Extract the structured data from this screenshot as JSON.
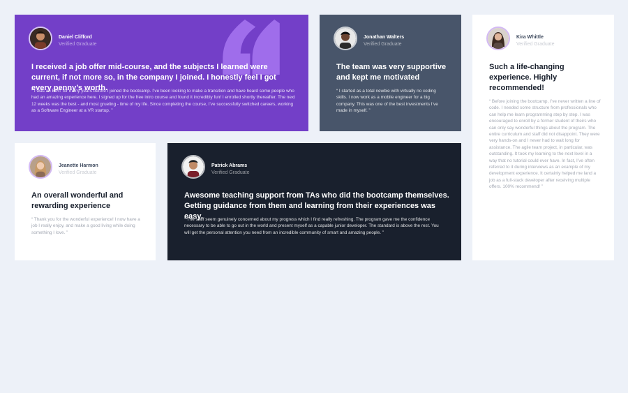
{
  "colors": {
    "page_bg": "#edf1f8",
    "purple": "#733fc8",
    "slate": "#48556a",
    "white": "#ffffff",
    "dark": "#19202d"
  },
  "testimonials": [
    {
      "name": "Daniel Clifford",
      "role": "Verified Graduate",
      "headline": "I received a job offer mid-course, and the subjects I learned were current, if not more so, in the company I joined. I honestly feel I got every penny’s worth.",
      "body": "“ I was an EMT for many years before I joined the bootcamp. I’ve been looking to make a transition and have heard some people who had an amazing experience here. I signed up for the free intro course and found it incredibly fun! I enrolled shortly thereafter. The next 12 weeks was the best - and most grueling - time of my life. Since completing the course, I’ve successfully switched careers, working as a Software Engineer at a VR startup. ”",
      "decor_icon": "quotation-mark-icon"
    },
    {
      "name": "Jonathan Walters",
      "role": "Verified Graduate",
      "headline": "The team was very supportive and kept me motivated",
      "body": "“ I started as a total newbie with virtually no coding skills. I now work as a mobile engineer for a big company. This was one of the best investments I’ve made in myself. ”"
    },
    {
      "name": "Kira Whittle",
      "role": "Verified Graduate",
      "headline": "Such a life-changing experience. Highly recommended!",
      "body": "“ Before joining the bootcamp, I’ve never written a line of code. I needed some structure from professionals who can help me learn programming step by step. I was encouraged to enroll by a former student of theirs who can only say wonderful things about the program. The entire curriculum and staff did not disappoint. They were very hands-on and I never had to wait long for assistance. The agile team project, in particular, was outstanding. It took my learning to the next level in a way that no tutorial could ever have. In fact, I’ve often referred to it during interviews as an example of my development experience. It certainly helped me land a job as a full-stack developer after receiving multiple offers. 100% recommend! ”"
    },
    {
      "name": "Jeanette Harmon",
      "role": "Verified Graduate",
      "headline": "An overall wonderful and rewarding experience",
      "body": "“ Thank you for the wonderful experience! I now have a job I really enjoy, and make a good living while doing something I love. ”"
    },
    {
      "name": "Patrick Abrams",
      "role": "Verified Graduate",
      "headline": "Awesome teaching support from TAs who did the bootcamp themselves. Getting guidance from them and learning from their experiences was easy.",
      "body": "“ The staff seem genuinely concerned about my progress which I find really refreshing. The program gave me the confidence necessary to be able to go out in the world and present myself as a capable junior developer. The standard is above the rest. You will get the personal attention you need from an incredible community of smart and amazing people. ”"
    }
  ]
}
